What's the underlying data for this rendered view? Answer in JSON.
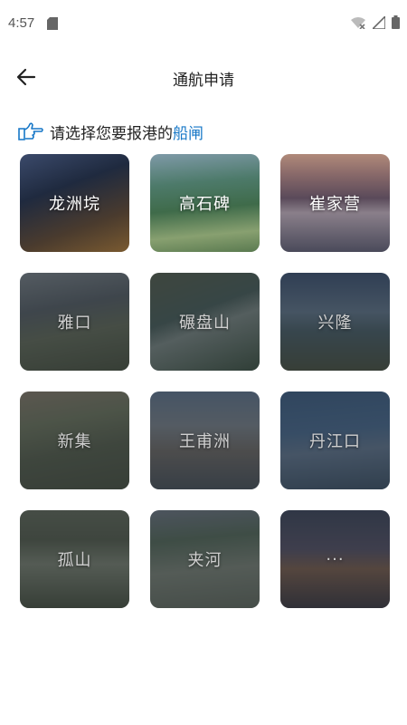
{
  "status": {
    "time": "4:57"
  },
  "header": {
    "title": "通航申请"
  },
  "prompt": {
    "text": "请选择您要报港的",
    "highlight": "船闸",
    "highlight_color": "#1677c7"
  },
  "locks": [
    {
      "name": "龙洲垸",
      "enabled": true
    },
    {
      "name": "高石碑",
      "enabled": true
    },
    {
      "name": "崔家营",
      "enabled": true
    },
    {
      "name": "雅口",
      "enabled": false
    },
    {
      "name": "碾盘山",
      "enabled": false
    },
    {
      "name": "兴隆",
      "enabled": false
    },
    {
      "name": "新集",
      "enabled": false
    },
    {
      "name": "王甫洲",
      "enabled": false
    },
    {
      "name": "丹江口",
      "enabled": false
    },
    {
      "name": "孤山",
      "enabled": false
    },
    {
      "name": "夹河",
      "enabled": false
    },
    {
      "name": "···",
      "enabled": false
    }
  ]
}
